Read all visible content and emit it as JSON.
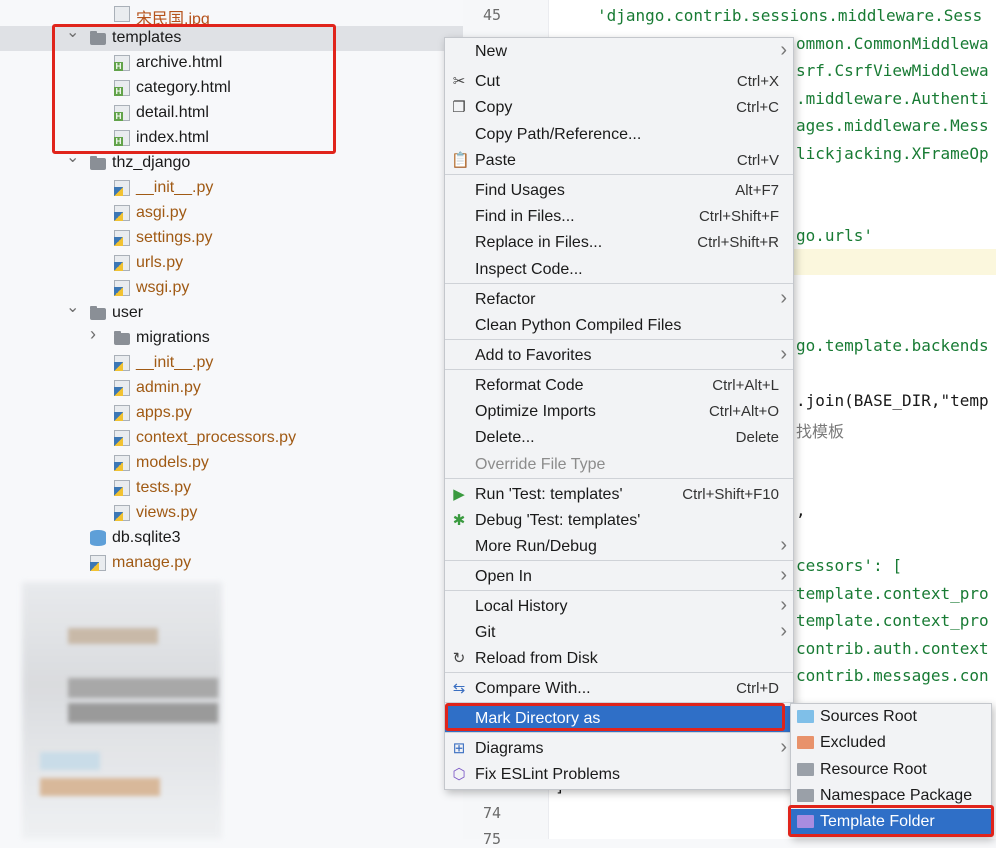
{
  "tree": {
    "items": [
      {
        "label": "宋民国.jpg",
        "kind": "image",
        "expanded": null,
        "selected": false
      },
      {
        "label": "templates",
        "kind": "folder",
        "expanded": true,
        "selected": true
      },
      {
        "label": "archive.html",
        "kind": "html",
        "expanded": null,
        "selected": false
      },
      {
        "label": "category.html",
        "kind": "html",
        "expanded": null,
        "selected": false
      },
      {
        "label": "detail.html",
        "kind": "html",
        "expanded": null,
        "selected": false
      },
      {
        "label": "index.html",
        "kind": "html",
        "expanded": null,
        "selected": false
      },
      {
        "label": "thz_django",
        "kind": "folder",
        "expanded": true,
        "selected": false
      },
      {
        "label": "__init__.py",
        "kind": "python",
        "expanded": null,
        "selected": false
      },
      {
        "label": "asgi.py",
        "kind": "python",
        "expanded": null,
        "selected": false
      },
      {
        "label": "settings.py",
        "kind": "python",
        "expanded": null,
        "selected": false
      },
      {
        "label": "urls.py",
        "kind": "python",
        "expanded": null,
        "selected": false
      },
      {
        "label": "wsgi.py",
        "kind": "python",
        "expanded": null,
        "selected": false
      },
      {
        "label": "user",
        "kind": "folder",
        "expanded": true,
        "selected": false
      },
      {
        "label": "migrations",
        "kind": "folder",
        "expanded": false,
        "selected": false
      },
      {
        "label": "__init__.py",
        "kind": "python",
        "expanded": null,
        "selected": false
      },
      {
        "label": "admin.py",
        "kind": "python",
        "expanded": null,
        "selected": false
      },
      {
        "label": "apps.py",
        "kind": "python",
        "expanded": null,
        "selected": false
      },
      {
        "label": "context_processors.py",
        "kind": "python",
        "expanded": null,
        "selected": false
      },
      {
        "label": "models.py",
        "kind": "python",
        "expanded": null,
        "selected": false
      },
      {
        "label": "tests.py",
        "kind": "python",
        "expanded": null,
        "selected": false
      },
      {
        "label": "views.py",
        "kind": "python",
        "expanded": null,
        "selected": false
      },
      {
        "label": "db.sqlite3",
        "kind": "database",
        "expanded": null,
        "selected": false
      },
      {
        "label": "manage.py",
        "kind": "python",
        "expanded": null,
        "selected": false
      }
    ]
  },
  "editor": {
    "line_numbers": [
      "45",
      "74",
      "75"
    ],
    "code_lines": [
      {
        "text": "'django.contrib.sessions.middleware.Sess",
        "style": "str"
      },
      {
        "text": "ommon.CommonMiddlewa",
        "style": "str"
      },
      {
        "text": "srf.CsrfViewMiddlewa",
        "style": "str"
      },
      {
        "text": ".middleware.Authenti",
        "style": "str"
      },
      {
        "text": "ages.middleware.Mess",
        "style": "str"
      },
      {
        "text": "lickjacking.XFrameOp",
        "style": "str"
      },
      {
        "text": "go.urls'",
        "style": "str"
      },
      {
        "text": "go.template.backends",
        "style": "str"
      },
      {
        "text": ".join(BASE_DIR,\"temp",
        "style": "code"
      },
      {
        "text": "找模板",
        "style": "gray"
      },
      {
        "text": ",",
        "style": "code"
      },
      {
        "text": "cessors': [",
        "style": "str"
      },
      {
        "text": "template.context_pro",
        "style": "str"
      },
      {
        "text": "template.context_pro",
        "style": "str"
      },
      {
        "text": "contrib.auth.context",
        "style": "str"
      },
      {
        "text": "contrib.messages.con",
        "style": "str"
      },
      {
        "text": "]",
        "style": "code"
      }
    ]
  },
  "context_menu": {
    "items": [
      {
        "label": "New",
        "mnemonic": "N",
        "shortcut": "",
        "submenu": true,
        "icon": "",
        "disabled": false
      },
      {
        "label": "Cut",
        "mnemonic": "t",
        "shortcut": "Ctrl+X",
        "submenu": false,
        "icon": "scissors-icon",
        "disabled": false
      },
      {
        "label": "Copy",
        "mnemonic": "C",
        "shortcut": "Ctrl+C",
        "submenu": false,
        "icon": "copy-icon",
        "disabled": false
      },
      {
        "label": "Copy Path/Reference...",
        "mnemonic": "",
        "shortcut": "",
        "submenu": false,
        "icon": "",
        "disabled": false
      },
      {
        "label": "Paste",
        "mnemonic": "P",
        "shortcut": "Ctrl+V",
        "submenu": false,
        "icon": "paste-icon",
        "disabled": false
      },
      {
        "label": "Find Usages",
        "mnemonic": "U",
        "shortcut": "Alt+F7",
        "submenu": false,
        "icon": "",
        "disabled": false
      },
      {
        "label": "Find in Files...",
        "mnemonic": "",
        "shortcut": "Ctrl+Shift+F",
        "submenu": false,
        "icon": "",
        "disabled": false
      },
      {
        "label": "Replace in Files...",
        "mnemonic": "",
        "shortcut": "Ctrl+Shift+R",
        "submenu": false,
        "icon": "",
        "disabled": false
      },
      {
        "label": "Inspect Code...",
        "mnemonic": "",
        "shortcut": "",
        "submenu": false,
        "icon": "",
        "disabled": false
      },
      {
        "label": "Refactor",
        "mnemonic": "R",
        "shortcut": "",
        "submenu": true,
        "icon": "",
        "disabled": false
      },
      {
        "label": "Clean Python Compiled Files",
        "mnemonic": "",
        "shortcut": "",
        "submenu": false,
        "icon": "",
        "disabled": false
      },
      {
        "label": "Add to Favorites",
        "mnemonic": "",
        "shortcut": "",
        "submenu": true,
        "icon": "",
        "disabled": false
      },
      {
        "label": "Reformat Code",
        "mnemonic": "R",
        "shortcut": "Ctrl+Alt+L",
        "submenu": false,
        "icon": "",
        "disabled": false
      },
      {
        "label": "Optimize Imports",
        "mnemonic": "",
        "shortcut": "Ctrl+Alt+O",
        "submenu": false,
        "icon": "",
        "disabled": false
      },
      {
        "label": "Delete...",
        "mnemonic": "D",
        "shortcut": "Delete",
        "submenu": false,
        "icon": "",
        "disabled": false
      },
      {
        "label": "Override File Type",
        "mnemonic": "",
        "shortcut": "",
        "submenu": false,
        "icon": "",
        "disabled": true
      },
      {
        "label": "Run 'Test: templates'",
        "mnemonic": "R",
        "shortcut": "Ctrl+Shift+F10",
        "submenu": false,
        "icon": "run-icon",
        "disabled": false
      },
      {
        "label": "Debug 'Test: templates'",
        "mnemonic": "D",
        "shortcut": "",
        "submenu": false,
        "icon": "debug-icon",
        "disabled": false
      },
      {
        "label": "More Run/Debug",
        "mnemonic": "",
        "shortcut": "",
        "submenu": true,
        "icon": "",
        "disabled": false
      },
      {
        "label": "Open In",
        "mnemonic": "",
        "shortcut": "",
        "submenu": true,
        "icon": "",
        "disabled": false
      },
      {
        "label": "Local History",
        "mnemonic": "H",
        "shortcut": "",
        "submenu": true,
        "icon": "",
        "disabled": false
      },
      {
        "label": "Git",
        "mnemonic": "G",
        "shortcut": "",
        "submenu": true,
        "icon": "",
        "disabled": false
      },
      {
        "label": "Reload from Disk",
        "mnemonic": "",
        "shortcut": "",
        "submenu": false,
        "icon": "reload-icon",
        "disabled": false
      },
      {
        "label": "Compare With...",
        "mnemonic": "",
        "shortcut": "Ctrl+D",
        "submenu": false,
        "icon": "compare-icon",
        "disabled": false
      },
      {
        "label": "Mark Directory as",
        "mnemonic": "",
        "shortcut": "",
        "submenu": true,
        "icon": "",
        "disabled": false,
        "active": true
      },
      {
        "label": "Diagrams",
        "mnemonic": "",
        "shortcut": "",
        "submenu": true,
        "icon": "diagram-icon",
        "disabled": false
      },
      {
        "label": "Fix ESLint Problems",
        "mnemonic": "",
        "shortcut": "",
        "submenu": false,
        "icon": "eslint-icon",
        "disabled": false
      }
    ]
  },
  "submenu": {
    "items": [
      {
        "label": "Sources Root",
        "color": "#7fbfe8",
        "active": false
      },
      {
        "label": "Excluded",
        "color": "#e8926b",
        "active": false
      },
      {
        "label": "Resource Root",
        "color": "#9aa0a8",
        "active": false
      },
      {
        "label": "Namespace Package",
        "color": "#9aa0a8",
        "active": false
      },
      {
        "label": "Template Folder",
        "color": "#a98ce0",
        "active": true
      }
    ]
  },
  "colors": {
    "accent": "#2f6fc7",
    "highlight_box": "#e0241b",
    "tree_selection": "#dfe1e5"
  }
}
